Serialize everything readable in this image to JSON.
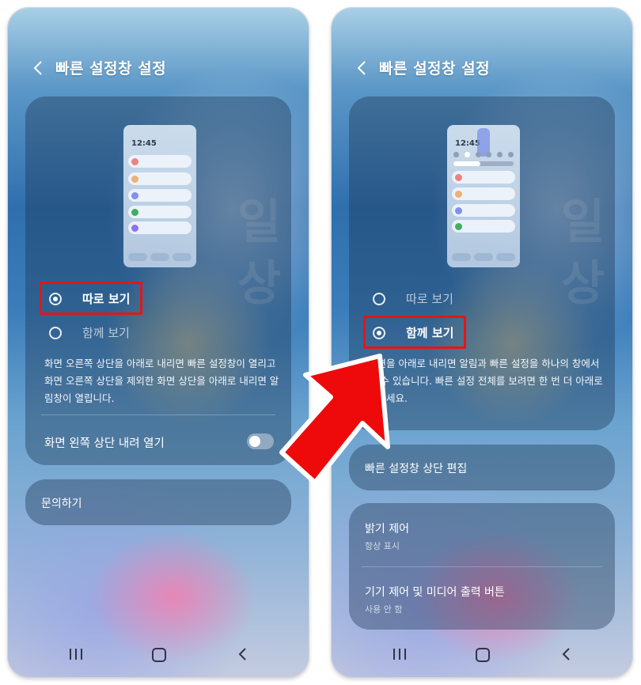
{
  "left": {
    "title": "빠른 설정창 설정",
    "preview_time": "12:45",
    "option1": "따로 보기",
    "option2": "함께 보기",
    "description": "화면 오른쪽 상단을 아래로 내리면 빠른 설정창이 열리고 화면 오른쪽 상단을 제외한 화면 상단을 아래로 내리면 알림창이 열립니다.",
    "toggle_label": "화면 왼쪽 상단 내려 열기",
    "contact": "문의하기",
    "bg_text": "일상"
  },
  "right": {
    "title": "빠른 설정창 설정",
    "preview_time": "12:45",
    "option1": "따로 보기",
    "option2": "함께 보기",
    "description": "화면을 아래로 내리면 알림과 빠른 설정을 하나의 창에서 볼 수 있습니다. 빠른 설정 전체를 보려면 한 번 더 아래로 내리세요.",
    "edit_top": "빠른 설정창 상단 편집",
    "brightness_title": "밝기 제어",
    "brightness_sub": "항상 표시",
    "media_title": "기기 제어 및 미디어 출력 버튼",
    "media_sub": "사용 안 함",
    "bg_text": "일상"
  },
  "colors": {
    "highlight": "#e61515",
    "dots": [
      "#f08080",
      "#f0b070",
      "#8090f0",
      "#40b060",
      "#9070f0"
    ]
  },
  "icons": [
    "chevron-left-icon",
    "recents-icon",
    "home-icon",
    "back-icon",
    "radio-selected-icon",
    "radio-unselected-icon",
    "toggle-icon",
    "red-arrow-icon"
  ]
}
